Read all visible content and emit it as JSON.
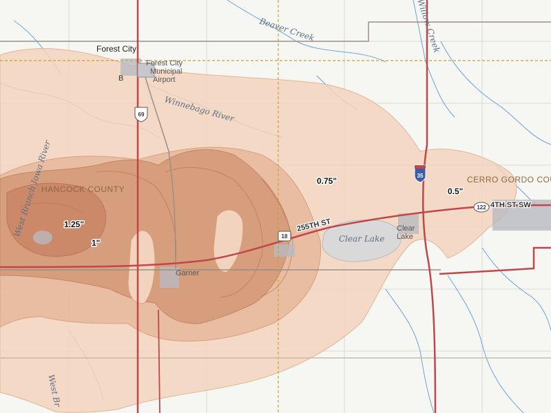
{
  "map": {
    "places": {
      "forest_city": "Forest City",
      "airport": "Forest City Municipal Airport",
      "garner": "Garner",
      "clear_lake_town": "Clear Lake"
    },
    "water": {
      "beaver_creek": "Beaver Creek",
      "winnebago_river": "Winnebago River",
      "west_branch_iowa_river": "West Branch Iowa River",
      "west_branch_short": "West Br",
      "clear_lake": "Clear Lake",
      "willow_creek": "Willow Creek"
    },
    "counties": {
      "hancock": "HANCOCK COUNTY",
      "cerro_gordo": "CERRO GORDO COU"
    },
    "roads": {
      "st_255": "255TH ST",
      "st_4th_sw": "4TH ST SW",
      "us_69": "69",
      "ia_18": "18",
      "i_35": "35",
      "rt_122": "122"
    },
    "precip_labels": {
      "in_125": "1.25\"",
      "in_1": "1\"",
      "in_075": "0.75\"",
      "in_05": "0.5\""
    },
    "colors": {
      "contour_050": "#f2d3bd",
      "contour_075": "#e8b99c",
      "contour_100": "#d59a7a",
      "contour_125": "#c98565",
      "highway": "#c0464a",
      "water_line": "#3b86d1",
      "county_border": "#c9a227"
    }
  }
}
